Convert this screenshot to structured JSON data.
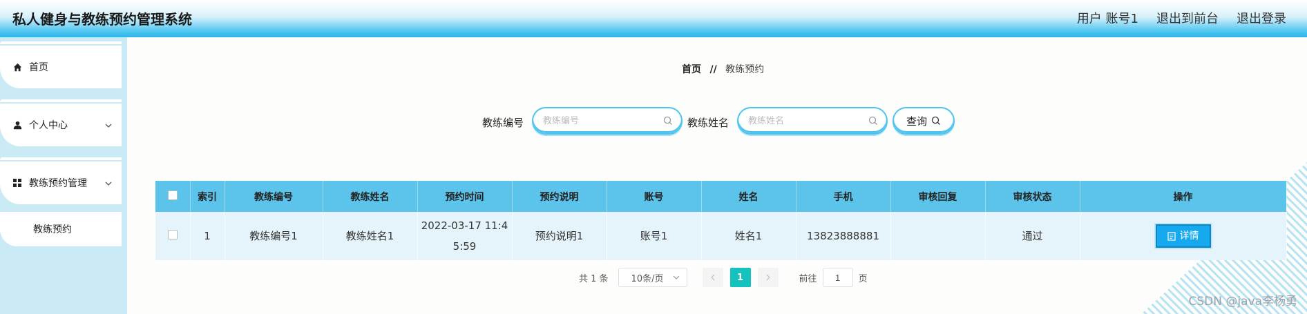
{
  "header": {
    "title": "私人健身与教练预约管理系统",
    "user_label": "用户 账号1",
    "front_link": "退出到前台",
    "logout_link": "退出登录"
  },
  "sidebar": {
    "items": [
      {
        "label": "首页",
        "icon": "home-icon"
      },
      {
        "label": "个人中心",
        "icon": "user-icon"
      },
      {
        "label": "教练预约管理",
        "icon": "grid-icon"
      }
    ],
    "sub_items": [
      {
        "label": "教练预约"
      }
    ]
  },
  "breadcrumb": {
    "home": "首页",
    "separator": "//",
    "current": "教练预约"
  },
  "search": {
    "coach_no_label": "教练编号",
    "coach_no_placeholder": "教练编号",
    "coach_name_label": "教练姓名",
    "coach_name_placeholder": "教练姓名",
    "query_button": "查询"
  },
  "table": {
    "columns": [
      "索引",
      "教练编号",
      "教练姓名",
      "预约时间",
      "预约说明",
      "账号",
      "姓名",
      "手机",
      "审核回复",
      "审核状态",
      "操作"
    ],
    "rows": [
      {
        "index": "1",
        "coach_no": "教练编号1",
        "coach_name": "教练姓名1",
        "time_line1": "2022-03-17 11:4",
        "time_line2": "5:59",
        "desc": "预约说明1",
        "account": "账号1",
        "name": "姓名1",
        "phone": "13823888881",
        "reply": "",
        "status": "通过",
        "action": "详情"
      }
    ]
  },
  "pagination": {
    "total": "共 1 条",
    "page_size": "10条/页",
    "current_page": "1",
    "goto_label": "前往",
    "goto_value": "1",
    "page_suffix": "页"
  },
  "watermark": "CSDN @java李杨勇",
  "colors": {
    "accent": "#5cc3ea",
    "primary_button": "#17a9ee",
    "active_page": "#16c2bd",
    "sidebar_bg": "#caeaf6"
  }
}
